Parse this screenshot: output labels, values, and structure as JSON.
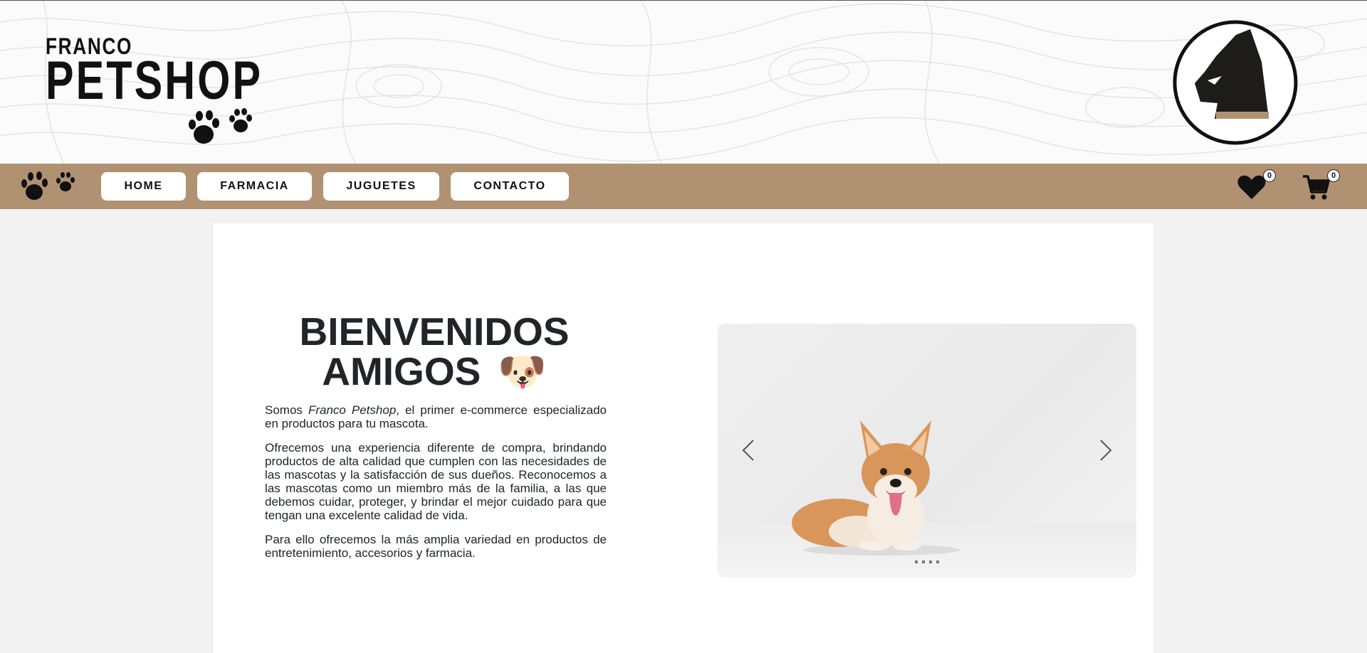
{
  "brand": {
    "small": "FRANCO",
    "big": "PETSHOP"
  },
  "nav": {
    "items": [
      {
        "label": "HOME"
      },
      {
        "label": "FARMACIA"
      },
      {
        "label": "JUGUETES"
      },
      {
        "label": "CONTACTO"
      }
    ],
    "favorites_count": "0",
    "cart_count": "0"
  },
  "main": {
    "title_line1": "BIENVENIDOS",
    "title_line2": "AMIGOS",
    "title_emoji": "🐶",
    "p1_before": "Somos ",
    "p1_brand": "Franco Petshop",
    "p1_after": ", el primer e-commerce especializado en productos para tu mascota.",
    "p2": "Ofrecemos una experiencia diferente de compra, brindando productos de alta calidad que cumplen con las necesidades de las mascotas y la satisfacción de sus dueños. Reconocemos a las mascotas como un miembro más de la familia, a las que debemos cuidar, proteger, y brindar el mejor cuidado para que tengan una excelente calidad de vida.",
    "p3": "Para ello ofrecemos la más amplia variedad en productos de entretenimiento, accesorios y farmacia."
  },
  "carousel": {
    "slide_count": 4,
    "active_index": 0,
    "image": "corgi-dog-lying-photo"
  },
  "icons": [
    "paw-prints-icon",
    "dog-head-logo-icon",
    "heart-icon",
    "cart-icon",
    "chevron-left-icon",
    "chevron-right-icon"
  ],
  "colors": {
    "navbar": "#b09273",
    "background": "#f2f2f2",
    "text": "#212529",
    "logo_gold": "#b09273"
  }
}
